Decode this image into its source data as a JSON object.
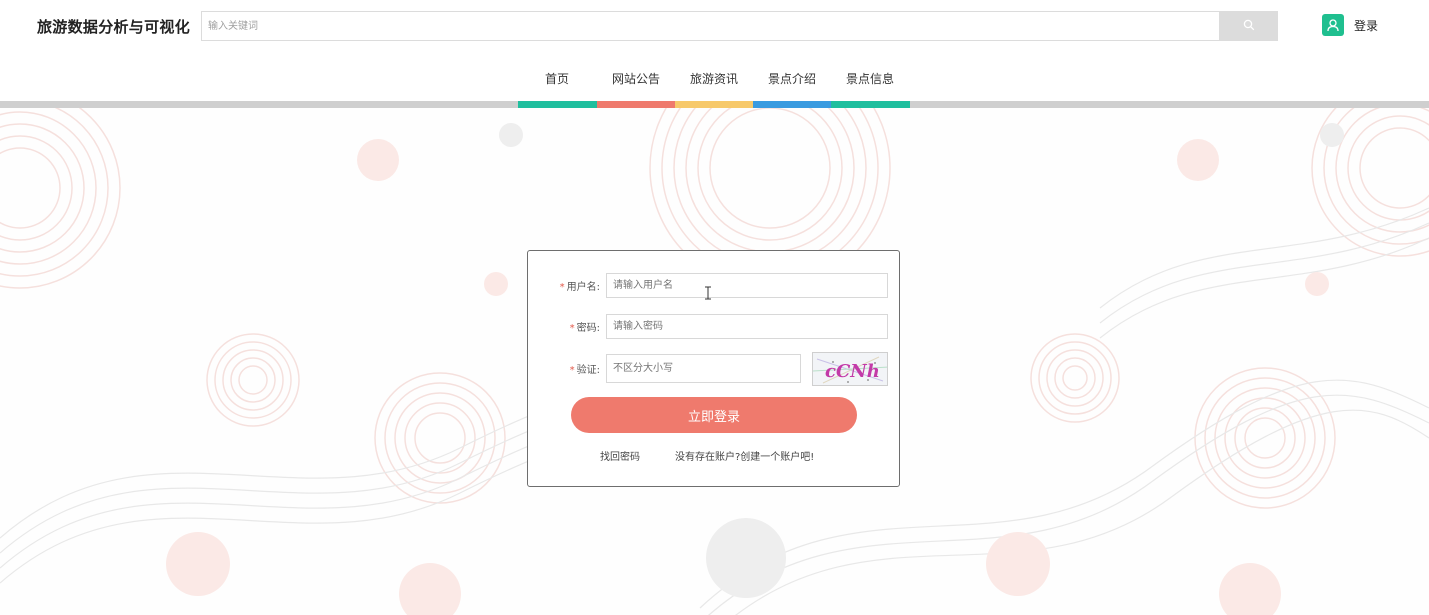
{
  "header": {
    "logo": "旅游数据分析与可视化",
    "search": {
      "placeholder": "输入关键词",
      "icon": "search-icon"
    },
    "login_label": "登录",
    "user_icon": "user-icon",
    "accent_color": "#1fbf8f"
  },
  "nav": {
    "items": [
      {
        "label": "首页",
        "color": "#1fbf9e"
      },
      {
        "label": "网站公告",
        "color": "#ef7a6d"
      },
      {
        "label": "旅游资讯",
        "color": "#f7c96b"
      },
      {
        "label": "景点介绍",
        "color": "#3a9be0"
      },
      {
        "label": "景点信息",
        "color": "#1fbf9e"
      }
    ]
  },
  "login_form": {
    "username": {
      "label": "用户名:",
      "placeholder": "请输入用户名"
    },
    "password": {
      "label": "密码:",
      "placeholder": "请输入密码"
    },
    "captcha": {
      "label": "验证:",
      "placeholder": "不区分大小写",
      "text": "cCNh"
    },
    "submit_label": "立即登录",
    "forgot_label": "找回密码",
    "register_label": "没有存在账户?创建一个账户吧!",
    "button_color": "#ef7a6d"
  }
}
